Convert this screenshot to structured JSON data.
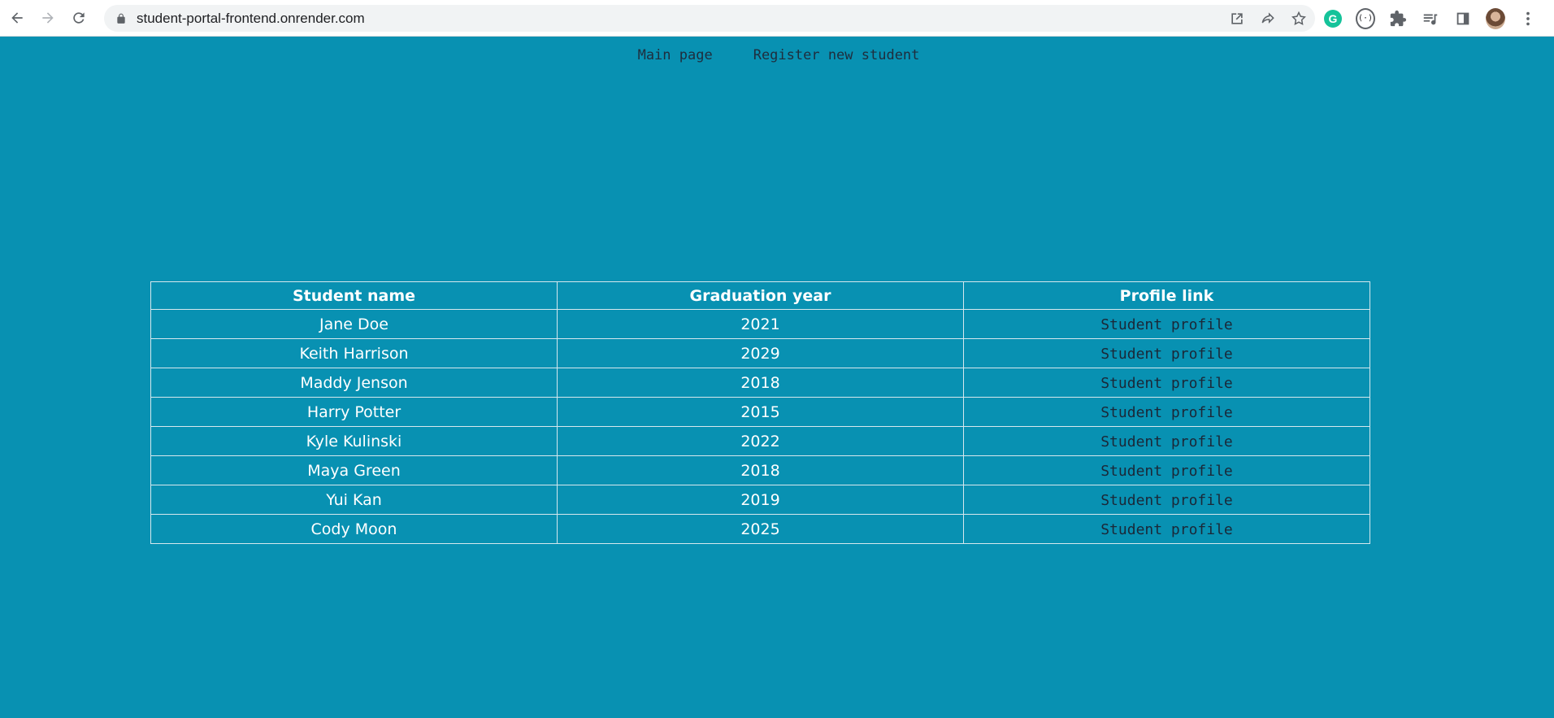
{
  "browser": {
    "url": "student-portal-frontend.onrender.com",
    "icons": [
      "back-icon",
      "forward-icon",
      "reload-icon",
      "lock-icon",
      "install-icon",
      "share-icon",
      "bookmark-star-icon",
      "grammarly-icon",
      "extension-icon",
      "puzzle-icon",
      "reading-list-icon",
      "side-panel-icon",
      "profile-avatar",
      "more-icon"
    ],
    "grammarly_letter": "G",
    "ext_label": "(·)"
  },
  "nav": {
    "main_page": "Main page",
    "register": "Register new student"
  },
  "table": {
    "headers": [
      "Student name",
      "Graduation year",
      "Profile link"
    ],
    "rows": [
      {
        "name": "Jane Doe",
        "year": "2021",
        "link": "Student profile"
      },
      {
        "name": "Keith Harrison",
        "year": "2029",
        "link": "Student profile"
      },
      {
        "name": "Maddy Jenson",
        "year": "2018",
        "link": "Student profile"
      },
      {
        "name": "Harry Potter",
        "year": "2015",
        "link": "Student profile"
      },
      {
        "name": "Kyle Kulinski",
        "year": "2022",
        "link": "Student profile"
      },
      {
        "name": "Maya Green",
        "year": "2018",
        "link": "Student profile"
      },
      {
        "name": "Yui Kan",
        "year": "2019",
        "link": "Student profile"
      },
      {
        "name": "Cody Moon",
        "year": "2025",
        "link": "Student profile"
      }
    ]
  },
  "colors": {
    "page_background": "#0891b2",
    "link_text": "#1b2838",
    "cell_text": "#ffffff"
  }
}
